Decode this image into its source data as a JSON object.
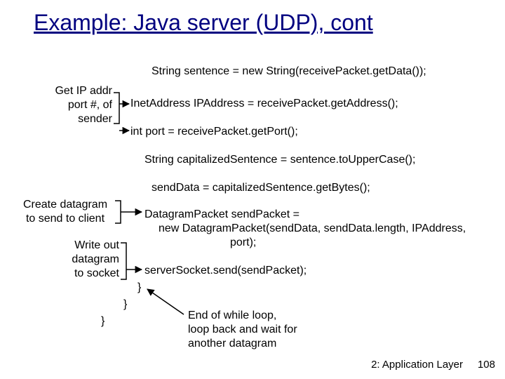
{
  "title": "Example: Java server (UDP), cont",
  "code": {
    "l1": "String sentence = new String(receivePacket.getData());",
    "l2": "InetAddress IPAddress = receivePacket.getAddress();",
    "l3": "int port = receivePacket.getPort();",
    "l4": "String capitalizedSentence = sentence.toUpperCase();",
    "l5": "sendData = capitalizedSentence.getBytes();",
    "l6a": "DatagramPacket sendPacket =",
    "l6b": "new DatagramPacket(sendData, sendData.length, IPAddress,",
    "l6c": "port);",
    "l7": "serverSocket.send(sendPacket);",
    "l8": "}",
    "l9": "}",
    "l10": "}"
  },
  "annot": {
    "a1_l1": "Get IP addr",
    "a1_l2": "port #, of",
    "a1_l3": "sender",
    "a2_l1": "Create datagram",
    "a2_l2": "to send to client",
    "a3_l1": "Write out",
    "a3_l2": "datagram",
    "a3_l3": "to socket",
    "a4_l1": "End of while loop,",
    "a4_l2": "loop back and wait for",
    "a4_l3": "another datagram"
  },
  "footer": "2: Application Layer",
  "page": "108"
}
